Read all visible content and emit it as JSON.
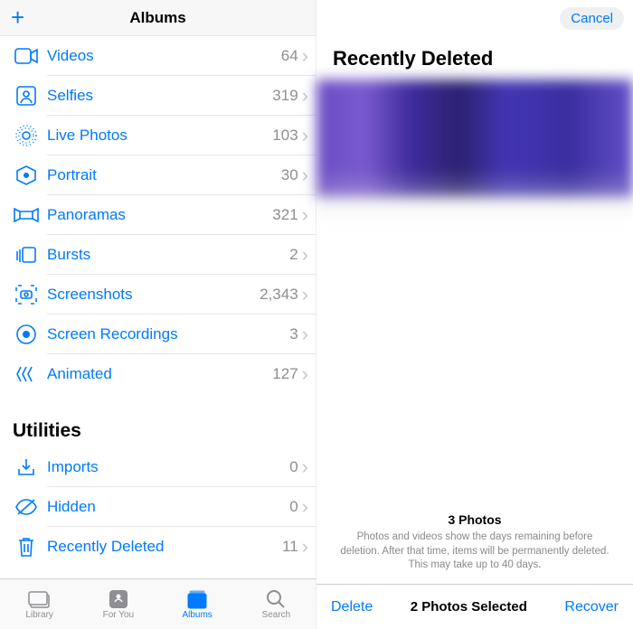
{
  "leftHeader": {
    "title": "Albums"
  },
  "mediaTypes": [
    {
      "key": "videos",
      "label": "Videos",
      "count": "64"
    },
    {
      "key": "selfies",
      "label": "Selfies",
      "count": "319"
    },
    {
      "key": "livephotos",
      "label": "Live Photos",
      "count": "103"
    },
    {
      "key": "portrait",
      "label": "Portrait",
      "count": "30"
    },
    {
      "key": "panoramas",
      "label": "Panoramas",
      "count": "321"
    },
    {
      "key": "bursts",
      "label": "Bursts",
      "count": "2"
    },
    {
      "key": "screenshots",
      "label": "Screenshots",
      "count": "2,343"
    },
    {
      "key": "screenrec",
      "label": "Screen Recordings",
      "count": "3"
    },
    {
      "key": "animated",
      "label": "Animated",
      "count": "127"
    }
  ],
  "utilitiesHeader": "Utilities",
  "utilities": [
    {
      "key": "imports",
      "label": "Imports",
      "count": "0"
    },
    {
      "key": "hidden",
      "label": "Hidden",
      "count": "0"
    },
    {
      "key": "recentdel",
      "label": "Recently Deleted",
      "count": "11"
    }
  ],
  "tabs": {
    "library": "Library",
    "foryou": "For You",
    "albums": "Albums",
    "search": "Search"
  },
  "right": {
    "cancel": "Cancel",
    "title": "Recently Deleted",
    "photoCount": "3 Photos",
    "desc": "Photos and videos show the days remaining before deletion. After that time, items will be permanently deleted. This may take up to 40 days.",
    "delete": "Delete",
    "selected": "2 Photos Selected",
    "recover": "Recover"
  }
}
